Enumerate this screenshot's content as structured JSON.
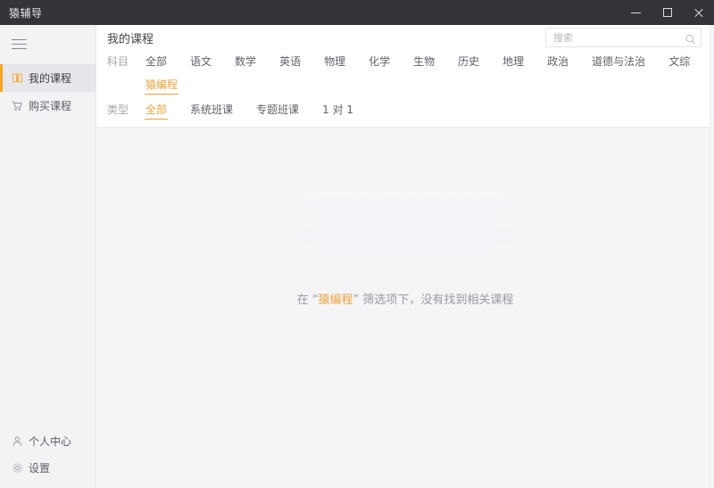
{
  "window": {
    "title": "猿辅导",
    "minimize_label": "最小化",
    "maximize_label": "最大化",
    "close_label": "关闭",
    "accent_color": "#f5a623",
    "titlebar_color": "#333338"
  },
  "sidebar": {
    "menu_toggle_label": "菜单",
    "items": [
      {
        "label": "我的课程",
        "icon": "book-icon",
        "active": true
      },
      {
        "label": "购买课程",
        "icon": "cart-icon",
        "active": false
      }
    ],
    "bottom_items": [
      {
        "label": "个人中心",
        "icon": "user-icon"
      },
      {
        "label": "设置",
        "icon": "gear-icon"
      }
    ]
  },
  "header": {
    "page_title": "我的课程"
  },
  "search": {
    "placeholder": "搜索",
    "value": "",
    "icon": "search-icon"
  },
  "filters": {
    "subject": {
      "label": "科目",
      "options": [
        "全部",
        "语文",
        "数学",
        "英语",
        "物理",
        "化学",
        "生物",
        "历史",
        "地理",
        "政治",
        "道德与法治",
        "文综",
        "猿编程"
      ],
      "selected": "猿编程"
    },
    "type": {
      "label": "类型",
      "options": [
        "全部",
        "系统班课",
        "专题班课",
        "1 对 1"
      ],
      "selected": "全部"
    }
  },
  "empty_state": {
    "illustration": "empty-box-illustration",
    "prefix": "在 “",
    "highlight": "猿编程",
    "suffix": "” 筛选项下，没有找到相关课程"
  }
}
